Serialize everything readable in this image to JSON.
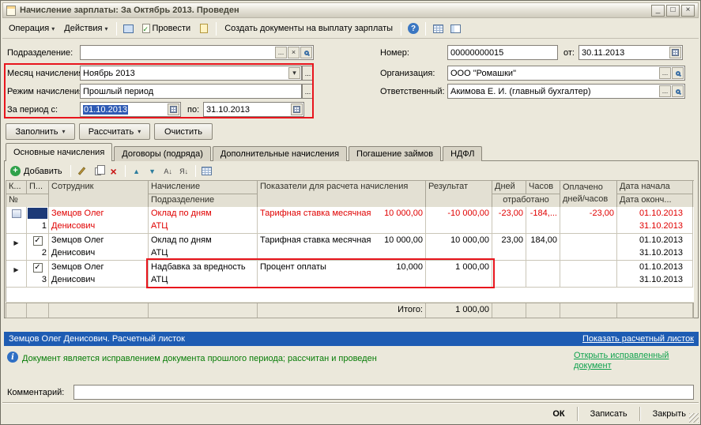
{
  "window": {
    "title": "Начисление зарплаты: За Октябрь 2013. Проведен",
    "minimize": "_",
    "maximize": "□",
    "close": "×"
  },
  "toolbar": {
    "operation": "Операция",
    "actions": "Действия",
    "post": "Провести",
    "create_docs": "Создать документы на выплату зарплаты"
  },
  "form": {
    "department_label": "Подразделение:",
    "department_value": "",
    "month_label": "Месяц начисления:",
    "month_value": "Ноябрь 2013",
    "mode_label": "Режим начисления:",
    "mode_value": "Прошлый период",
    "period_label": "За период с:",
    "period_from": "01.10.2013",
    "period_to_label": "по:",
    "period_to": "31.10.2013",
    "number_label": "Номер:",
    "number_value": "00000000015",
    "date_label": "от:",
    "date_value": "30.11.2013",
    "org_label": "Организация:",
    "org_value": "ООО \"Ромашки\"",
    "resp_label": "Ответственный:",
    "resp_value": "Акимова Е. И. (главный бухгалтер)"
  },
  "commands": {
    "fill": "Заполнить",
    "calculate": "Рассчитать",
    "clear": "Очистить"
  },
  "tabs": {
    "t1": "Основные начисления",
    "t2": "Договоры (подряда)",
    "t3": "Дополнительные начисления",
    "t4": "Погашение займов",
    "t5": "НДФЛ"
  },
  "grid_toolbar": {
    "add": "Добавить",
    "sort_az": "А↓",
    "sort_za": "Я↓"
  },
  "table": {
    "headers": {
      "k": "К...",
      "p": "П...",
      "num": "№",
      "employee": "Сотрудник",
      "accrual": "Начисление",
      "department": "Подразделение",
      "indicators": "Показатели для расчета начисления",
      "result": "Результат",
      "days": "Дней",
      "hours": "Часов",
      "worked": "отработано",
      "paid": "Оплачено дней/часов",
      "date_start": "Дата начала",
      "date_end": "Дата оконч..."
    },
    "rows": [
      {
        "num": "1",
        "employee": "Земцов Олег Денисович",
        "accrual": "Оклад по дням",
        "department": "АТЦ",
        "indicator": "Тарифная ставка месячная",
        "indicator_value": "10 000,00",
        "result": "-10 000,00",
        "days": "-23,00",
        "hours": "-184,...",
        "paid": "-23,00",
        "date_start": "01.10.2013",
        "date_end": "31.10.2013"
      },
      {
        "num": "2",
        "employee": "Земцов Олег Денисович",
        "accrual": "Оклад по дням",
        "department": "АТЦ",
        "indicator": "Тарифная ставка месячная",
        "indicator_value": "10 000,00",
        "result": "10 000,00",
        "days": "23,00",
        "hours": "184,00",
        "paid": "",
        "date_start": "01.10.2013",
        "date_end": "31.10.2013"
      },
      {
        "num": "3",
        "employee": "Земцов Олег Денисович",
        "accrual": "Надбавка за вредность",
        "department": "АТЦ",
        "indicator": "Процент оплаты",
        "indicator_value": "10,000",
        "result": "1 000,00",
        "days": "",
        "hours": "",
        "paid": "",
        "date_start": "01.10.2013",
        "date_end": "31.10.2013"
      }
    ],
    "total_label": "Итого:",
    "total_value": "1 000,00"
  },
  "statusbar": {
    "text": "Земцов Олег Денисович. Расчетный листок",
    "link": "Показать расчетный листок"
  },
  "info": {
    "message": "Документ является исправлением документа прошлого периода; рассчитан и проведен",
    "link": "Открыть исправленный документ"
  },
  "comment": {
    "label": "Комментарий:",
    "value": ""
  },
  "footer": {
    "ok": "ОК",
    "write": "Записать",
    "close": "Закрыть"
  },
  "icons": {
    "dropdown": "▾",
    "ellipsis": "...",
    "clear": "×",
    "check": "✓",
    "marker": "▶",
    "help": "?",
    "info": "i",
    "add": "+",
    "delete": "×",
    "up": "▲",
    "down": "▼"
  },
  "colors": {
    "annotation": "#e8151d",
    "storno_text": "#e00000",
    "statusbar_bg": "#1e5cb3",
    "info_text": "#067c06",
    "link_green": "#11a24e"
  }
}
